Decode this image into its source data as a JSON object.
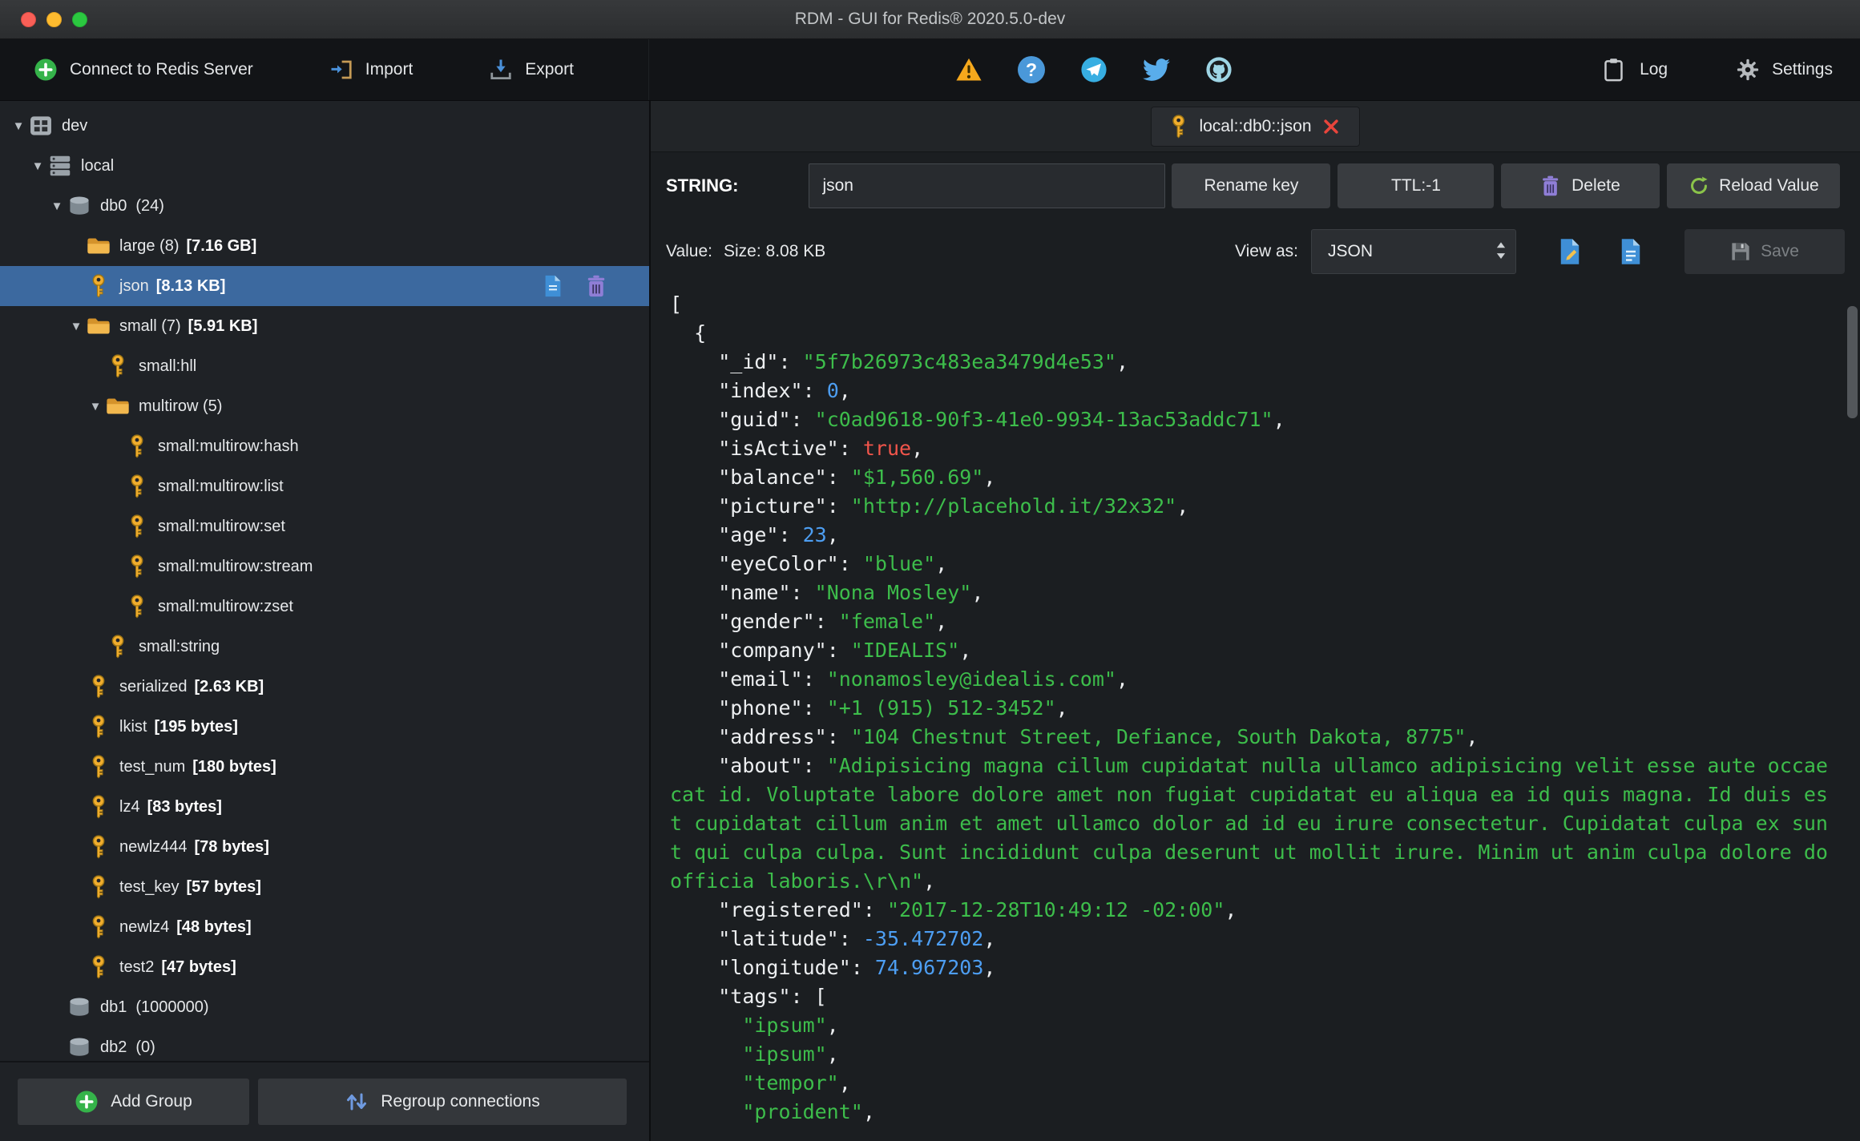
{
  "window": {
    "title": "RDM - GUI for Redis® 2020.5.0-dev"
  },
  "toolbar": {
    "connect_label": "Connect to Redis Server",
    "import_label": "Import",
    "export_label": "Export",
    "log_label": "Log",
    "settings_label": "Settings"
  },
  "sidebar": {
    "tree": [
      {
        "depth": 0,
        "icon": "server",
        "label": "dev",
        "expanded": true
      },
      {
        "depth": 1,
        "icon": "dbstack",
        "label": "local",
        "expanded": true
      },
      {
        "depth": 2,
        "icon": "db",
        "label": "db0",
        "suffix": "(24)",
        "expanded": true
      },
      {
        "depth": 3,
        "icon": "folder",
        "label": "large (8)",
        "size": "[7.16 GB]"
      },
      {
        "depth": 3,
        "icon": "key",
        "label": "json",
        "size": "[8.13 KB]",
        "selected": true,
        "actions": true
      },
      {
        "depth": 3,
        "icon": "folder",
        "label": "small (7)",
        "size": "[5.91 KB]",
        "expanded": true
      },
      {
        "depth": 4,
        "icon": "key",
        "label": "small:hll"
      },
      {
        "depth": 4,
        "icon": "folder",
        "label": "multirow (5)",
        "expanded": true
      },
      {
        "depth": 5,
        "icon": "key",
        "label": "small:multirow:hash"
      },
      {
        "depth": 5,
        "icon": "key",
        "label": "small:multirow:list"
      },
      {
        "depth": 5,
        "icon": "key",
        "label": "small:multirow:set"
      },
      {
        "depth": 5,
        "icon": "key",
        "label": "small:multirow:stream"
      },
      {
        "depth": 5,
        "icon": "key",
        "label": "small:multirow:zset"
      },
      {
        "depth": 4,
        "icon": "key",
        "label": "small:string"
      },
      {
        "depth": 3,
        "icon": "key",
        "label": "serialized",
        "size": "[2.63 KB]"
      },
      {
        "depth": 3,
        "icon": "key",
        "label": "lkist",
        "size": "[195 bytes]"
      },
      {
        "depth": 3,
        "icon": "key",
        "label": "test_num",
        "size": "[180 bytes]"
      },
      {
        "depth": 3,
        "icon": "key",
        "label": "lz4",
        "size": "[83 bytes]"
      },
      {
        "depth": 3,
        "icon": "key",
        "label": "newlz444",
        "size": "[78 bytes]"
      },
      {
        "depth": 3,
        "icon": "key",
        "label": "test_key",
        "size": "[57 bytes]"
      },
      {
        "depth": 3,
        "icon": "key",
        "label": "newlz4",
        "size": "[48 bytes]"
      },
      {
        "depth": 3,
        "icon": "key",
        "label": "test2",
        "size": "[47 bytes]"
      },
      {
        "depth": 2,
        "icon": "db",
        "label": "db1",
        "suffix": "(1000000)"
      },
      {
        "depth": 2,
        "icon": "db",
        "label": "db2",
        "suffix": "(0)"
      }
    ],
    "footer": {
      "add_group_label": "Add Group",
      "regroup_label": "Regroup connections"
    }
  },
  "main": {
    "tab": {
      "label": "local::db0::json"
    },
    "key_row": {
      "type_label": "STRING:",
      "key_value": "json",
      "rename_label": "Rename key",
      "ttl_label": "TTL:-1",
      "delete_label": "Delete",
      "reload_label": "Reload Value"
    },
    "value_row": {
      "value_label": "Value:",
      "size_label": "Size: 8.08 KB",
      "view_as_label": "View as:",
      "view_mode": "JSON",
      "save_label": "Save"
    }
  },
  "json_view": {
    "lines": [
      [
        [
          "p",
          "["
        ]
      ],
      [
        [
          "p",
          "  {"
        ]
      ],
      [
        [
          "p",
          "    "
        ],
        [
          "k",
          "\"_id\""
        ],
        [
          "p",
          ": "
        ],
        [
          "s",
          "\"5f7b26973c483ea3479d4e53\""
        ],
        [
          "p",
          ","
        ]
      ],
      [
        [
          "p",
          "    "
        ],
        [
          "k",
          "\"index\""
        ],
        [
          "p",
          ": "
        ],
        [
          "n",
          "0"
        ],
        [
          "p",
          ","
        ]
      ],
      [
        [
          "p",
          "    "
        ],
        [
          "k",
          "\"guid\""
        ],
        [
          "p",
          ": "
        ],
        [
          "s",
          "\"c0ad9618-90f3-41e0-9934-13ac53addc71\""
        ],
        [
          "p",
          ","
        ]
      ],
      [
        [
          "p",
          "    "
        ],
        [
          "k",
          "\"isActive\""
        ],
        [
          "p",
          ": "
        ],
        [
          "b",
          "true"
        ],
        [
          "p",
          ","
        ]
      ],
      [
        [
          "p",
          "    "
        ],
        [
          "k",
          "\"balance\""
        ],
        [
          "p",
          ": "
        ],
        [
          "s",
          "\"$1,560.69\""
        ],
        [
          "p",
          ","
        ]
      ],
      [
        [
          "p",
          "    "
        ],
        [
          "k",
          "\"picture\""
        ],
        [
          "p",
          ": "
        ],
        [
          "s",
          "\"http://placehold.it/32x32\""
        ],
        [
          "p",
          ","
        ]
      ],
      [
        [
          "p",
          "    "
        ],
        [
          "k",
          "\"age\""
        ],
        [
          "p",
          ": "
        ],
        [
          "n",
          "23"
        ],
        [
          "p",
          ","
        ]
      ],
      [
        [
          "p",
          "    "
        ],
        [
          "k",
          "\"eyeColor\""
        ],
        [
          "p",
          ": "
        ],
        [
          "s",
          "\"blue\""
        ],
        [
          "p",
          ","
        ]
      ],
      [
        [
          "p",
          "    "
        ],
        [
          "k",
          "\"name\""
        ],
        [
          "p",
          ": "
        ],
        [
          "s",
          "\"Nona Mosley\""
        ],
        [
          "p",
          ","
        ]
      ],
      [
        [
          "p",
          "    "
        ],
        [
          "k",
          "\"gender\""
        ],
        [
          "p",
          ": "
        ],
        [
          "s",
          "\"female\""
        ],
        [
          "p",
          ","
        ]
      ],
      [
        [
          "p",
          "    "
        ],
        [
          "k",
          "\"company\""
        ],
        [
          "p",
          ": "
        ],
        [
          "s",
          "\"IDEALIS\""
        ],
        [
          "p",
          ","
        ]
      ],
      [
        [
          "p",
          "    "
        ],
        [
          "k",
          "\"email\""
        ],
        [
          "p",
          ": "
        ],
        [
          "s",
          "\"nonamosley@idealis.com\""
        ],
        [
          "p",
          ","
        ]
      ],
      [
        [
          "p",
          "    "
        ],
        [
          "k",
          "\"phone\""
        ],
        [
          "p",
          ": "
        ],
        [
          "s",
          "\"+1 (915) 512-3452\""
        ],
        [
          "p",
          ","
        ]
      ],
      [
        [
          "p",
          "    "
        ],
        [
          "k",
          "\"address\""
        ],
        [
          "p",
          ": "
        ],
        [
          "s",
          "\"104 Chestnut Street, Defiance, South Dakota, 8775\""
        ],
        [
          "p",
          ","
        ]
      ],
      [
        [
          "p",
          "    "
        ],
        [
          "k",
          "\"about\""
        ],
        [
          "p",
          ": "
        ],
        [
          "s",
          "\"Adipisicing magna cillum cupidatat nulla ullamco adipisicing velit esse aute occaecat id. Voluptate labore dolore amet non fugiat cupidatat eu aliqua ea id quis magna. Id duis est cupidatat cillum anim et amet ullamco dolor ad id eu irure consectetur. Cupidatat culpa ex sunt qui culpa culpa. Sunt incididunt culpa deserunt ut mollit irure. Minim ut anim culpa dolore do officia laboris.\\r\\n\""
        ],
        [
          "p",
          ","
        ]
      ],
      [
        [
          "p",
          "    "
        ],
        [
          "k",
          "\"registered\""
        ],
        [
          "p",
          ": "
        ],
        [
          "s",
          "\"2017-12-28T10:49:12 -02:00\""
        ],
        [
          "p",
          ","
        ]
      ],
      [
        [
          "p",
          "    "
        ],
        [
          "k",
          "\"latitude\""
        ],
        [
          "p",
          ": "
        ],
        [
          "n",
          "-35.472702"
        ],
        [
          "p",
          ","
        ]
      ],
      [
        [
          "p",
          "    "
        ],
        [
          "k",
          "\"longitude\""
        ],
        [
          "p",
          ": "
        ],
        [
          "n",
          "74.967203"
        ],
        [
          "p",
          ","
        ]
      ],
      [
        [
          "p",
          "    "
        ],
        [
          "k",
          "\"tags\""
        ],
        [
          "p",
          ": ["
        ]
      ],
      [
        [
          "p",
          "      "
        ],
        [
          "s",
          "\"ipsum\""
        ],
        [
          "p",
          ","
        ]
      ],
      [
        [
          "p",
          "      "
        ],
        [
          "s",
          "\"ipsum\""
        ],
        [
          "p",
          ","
        ]
      ],
      [
        [
          "p",
          "      "
        ],
        [
          "s",
          "\"tempor\""
        ],
        [
          "p",
          ","
        ]
      ],
      [
        [
          "p",
          "      "
        ],
        [
          "s",
          "\"proident\""
        ],
        [
          "p",
          ","
        ]
      ]
    ]
  }
}
